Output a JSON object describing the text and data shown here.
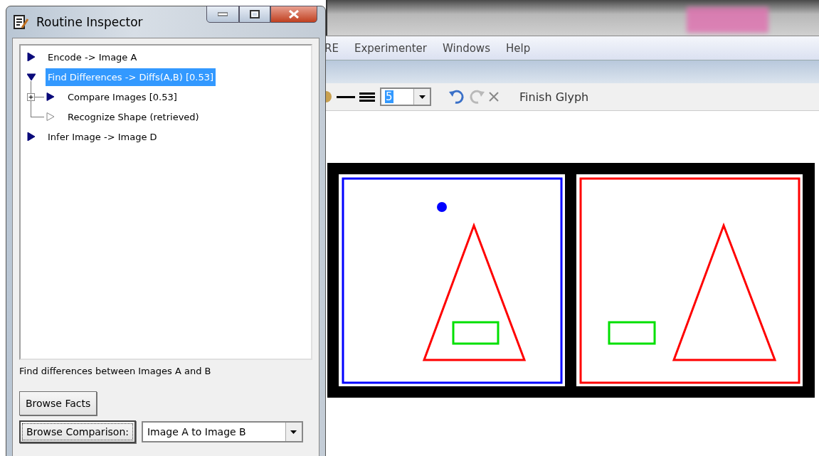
{
  "window": {
    "title": "Routine Inspector"
  },
  "tree": [
    {
      "label": "Encode -> Image A",
      "kind": "routine",
      "expanded": false,
      "selected": false
    },
    {
      "label": "Find Differences -> Diffs(A,B) [0.53]",
      "kind": "routine",
      "expanded": true,
      "selected": true,
      "children": [
        {
          "label": "Compare Images [0.53]",
          "kind": "routine",
          "expandable": true,
          "expanded": false,
          "selected": false
        },
        {
          "label": "Recognize Shape (retrieved)",
          "kind": "retrieved",
          "expandable": false,
          "expanded": false,
          "selected": false
        }
      ]
    },
    {
      "label": "Infer Image -> Image D",
      "kind": "routine",
      "expanded": false,
      "selected": false
    }
  ],
  "description": "Find differences between Images A and B",
  "browse_facts_button": "Browse Facts",
  "browse_comparison_button": "Browse Comparison:",
  "comparison_select": {
    "value": "Image A to Image B"
  },
  "background_app": {
    "menu": [
      "RE",
      "Experimenter",
      "Windows",
      "Help"
    ],
    "width_select": {
      "value": "5"
    },
    "undo_disabled": false,
    "redo_disabled": true,
    "clear_disabled": true,
    "finish_button": "Finish Glyph"
  }
}
